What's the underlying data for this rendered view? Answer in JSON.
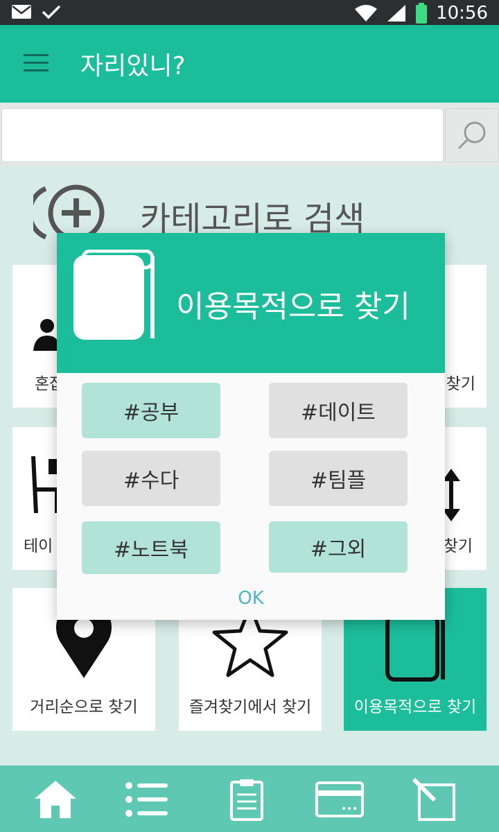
{
  "status_bar": {
    "time": "10:56"
  },
  "app_bar": {
    "title": "자리있니?"
  },
  "search": {
    "placeholder": ""
  },
  "category_section": {
    "title": "카테고리로 검색"
  },
  "cards": {
    "solo": "혼잡",
    "companion": "찾기",
    "table": "테이",
    "distance_right": "찾기",
    "distance": "거리순으로 찾기",
    "favorites": "즐겨찾기에서 찾기",
    "purpose": "이용목적으로 찾기"
  },
  "dialog": {
    "title": "이용목적으로 찾기",
    "tags": [
      "#공부",
      "#데이트",
      "#수다",
      "#팀플",
      "#노트북",
      "#그외"
    ],
    "ok_label": "OK"
  },
  "colors": {
    "accent": "#1bbd9b",
    "tag_selected": "#b1e3d8",
    "tag_unselected": "#e0e0e0"
  }
}
